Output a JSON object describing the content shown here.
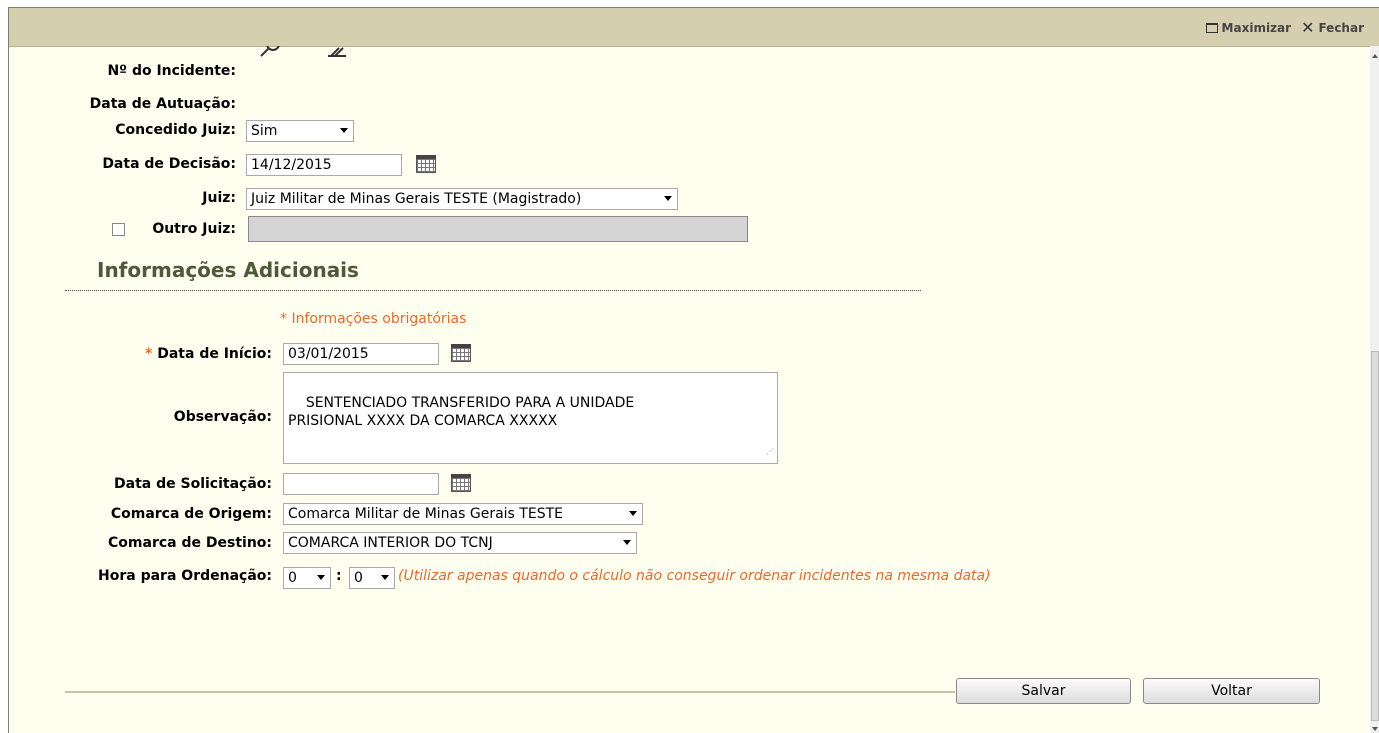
{
  "window": {
    "maximize_label": "Maximizar",
    "close_label": "Fechar"
  },
  "form": {
    "incidente_label": "Nº do Incidente:",
    "autuacao_label": "Data de Autuação:",
    "concedido_label": "Concedido Juiz:",
    "concedido_value": "Sim",
    "decisao_label": "Data de Decisão:",
    "decisao_value": "14/12/2015",
    "juiz_label": "Juiz:",
    "juiz_value": "Juiz Militar de Minas Gerais TESTE (Magistrado)",
    "outro_juiz_label": "Outro Juiz:",
    "outro_juiz_value": ""
  },
  "info": {
    "title": "Informações Adicionais",
    "required_note": "* Informações obrigatórias",
    "required_mark": "*",
    "inicio_label": "Data de Início:",
    "inicio_value": "03/01/2015",
    "observacao_label": "Observação:",
    "observacao_value": "SENTENCIADO TRANSFERIDO PARA A UNIDADE\nPRISIONAL XXXX DA COMARCA XXXXX",
    "solicitacao_label": "Data de Solicitação:",
    "solicitacao_value": "",
    "origem_label": "Comarca de Origem:",
    "origem_value": "Comarca Militar de Minas Gerais TESTE",
    "destino_label": "Comarca de Destino:",
    "destino_value": "COMARCA INTERIOR DO TCNJ",
    "hora_label": "Hora para Ordenação:",
    "hora_value": "0",
    "minuto_value": "0",
    "hora_sep": ":",
    "hora_note": "(Utilizar apenas quando o cálculo não conseguir ordenar incidentes na mesma data)"
  },
  "actions": {
    "save_label": "Salvar",
    "back_label": "Voltar"
  },
  "colors": {
    "accent": "#e8692e",
    "section_title": "#4d5a3a",
    "titlebar": "#d5cfb0",
    "background": "#fffff0"
  },
  "icons": [
    "search-icon",
    "eraser-icon",
    "calendar-icon",
    "maximize-icon",
    "close-icon"
  ]
}
